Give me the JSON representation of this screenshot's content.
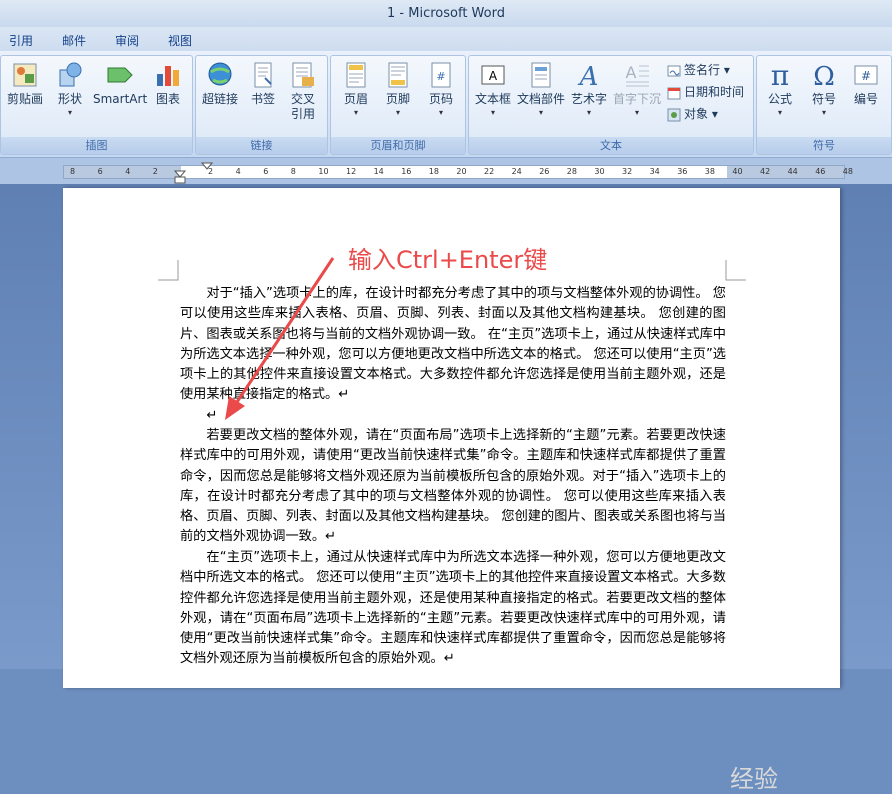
{
  "window": {
    "title": "1 - Microsoft Word"
  },
  "tabs": [
    "引用",
    "邮件",
    "审阅",
    "视图"
  ],
  "ribbon": {
    "groups": {
      "illustrations": {
        "label": "插图",
        "buttons": [
          "剪贴画",
          "形状",
          "SmartArt",
          "图表"
        ]
      },
      "links": {
        "label": "链接",
        "buttons": [
          "超链接",
          "书签",
          "交叉",
          "引用"
        ]
      },
      "header_footer": {
        "label": "页眉和页脚",
        "buttons": [
          "页眉",
          "页脚",
          "页码"
        ]
      },
      "text": {
        "label": "文本",
        "buttons": [
          "文本框",
          "文档部件",
          "艺术字",
          "首字下沉"
        ],
        "small": [
          "签名行",
          "日期和时间",
          "对象"
        ]
      },
      "symbols": {
        "label": "符号",
        "buttons": [
          "公式",
          "符号",
          "编号"
        ]
      }
    }
  },
  "ruler": {
    "ticks": [
      "8",
      "6",
      "4",
      "2",
      "",
      "2",
      "4",
      "6",
      "8",
      "10",
      "12",
      "14",
      "16",
      "18",
      "20",
      "22",
      "24",
      "26",
      "28",
      "30",
      "32",
      "34",
      "36",
      "38",
      "40",
      "42",
      "44",
      "46",
      "48"
    ]
  },
  "document": {
    "callout": "输入Ctrl+Enter键",
    "paragraphs": [
      "对于“插入”选项卡上的库，在设计时都充分考虑了其中的项与文档整体外观的协调性。 您可以使用这些库来插入表格、页眉、页脚、列表、封面以及其他文档构建基块。 您创建的图片、图表或关系图也将与当前的文档外观协调一致。 在“主页”选项卡上，通过从快速样式库中为所选文本选择一种外观，您可以方便地更改文档中所选文本的格式。 您还可以使用“主页”选项卡上的其他控件来直接设置文本格式。大多数控件都允许您选择是使用当前主题外观，还是使用某种直接指定的格式。↵",
      "↵",
      "若要更改文档的整体外观，请在“页面布局”选项卡上选择新的“主题”元素。若要更改快速样式库中的可用外观，请使用“更改当前快速样式集”命令。主题库和快速样式库都提供了重置命令，因而您总是能够将文档外观还原为当前模板所包含的原始外观。对于“插入”选项卡上的库，在设计时都充分考虑了其中的项与文档整体外观的协调性。 您可以使用这些库来插入表格、页眉、页脚、列表、封面以及其他文档构建基块。 您创建的图片、图表或关系图也将与当前的文档外观协调一致。↵",
      "在“主页”选项卡上，通过从快速样式库中为所选文本选择一种外观，您可以方便地更改文档中所选文本的格式。 您还可以使用“主页”选项卡上的其他控件来直接设置文本格式。大多数控件都允许您选择是使用当前主题外观，还是使用某种直接指定的格式。若要更改文档的整体外观，请在“页面布局”选项卡上选择新的“主题”元素。若要更改快速样式库中的可用外观，请使用“更改当前快速样式集”命令。主题库和快速样式库都提供了重置命令，因而您总是能够将文档外观还原为当前模板所包含的原始外观。↵"
    ]
  },
  "watermark": "经验",
  "colors": {
    "callout": "#ea4a4a",
    "ribbon_text": "#1e395b",
    "tab_text": "#15428b"
  }
}
